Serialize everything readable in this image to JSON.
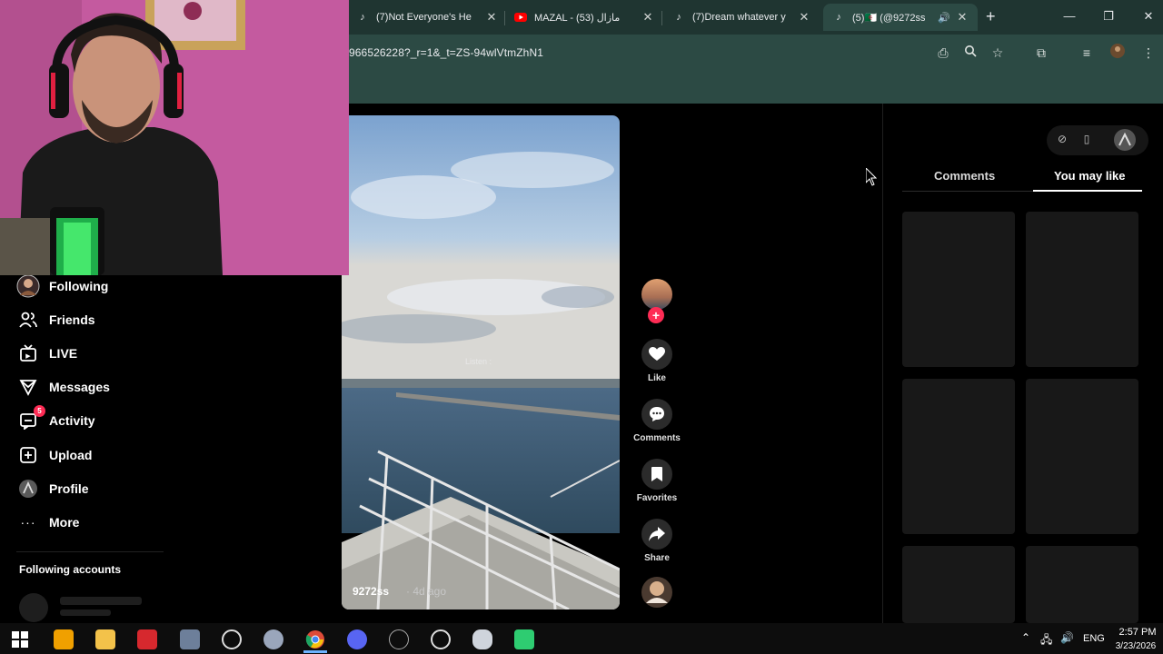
{
  "browser": {
    "tabs": [
      {
        "title": "(7)Not Everyone's He",
        "icon": "tiktok-icon",
        "active": false
      },
      {
        "title": "MAZAL - مازال (53)",
        "icon": "youtube-icon",
        "active": false
      },
      {
        "title": "(7)Dream whatever y",
        "icon": "tiktok-icon",
        "active": false
      },
      {
        "title": "(5)🇩🇿 (@9272ss)",
        "icon": "tiktok-icon",
        "active": true
      }
    ],
    "new_tab_symbol": "+",
    "url": "966526228?_r=1&_t=ZS-94wlVtmZhN1"
  },
  "sidebar": {
    "items": [
      {
        "label": "Following",
        "icon": "avatar-icon"
      },
      {
        "label": "Friends",
        "icon": "friends-icon"
      },
      {
        "label": "LIVE",
        "icon": "live-icon"
      },
      {
        "label": "Messages",
        "icon": "messages-icon"
      },
      {
        "label": "Activity",
        "icon": "activity-icon",
        "badge": "5"
      },
      {
        "label": "Upload",
        "icon": "upload-icon"
      },
      {
        "label": "Profile",
        "icon": "profile-icon"
      },
      {
        "label": "More",
        "icon": "more-icon"
      }
    ],
    "following_accounts": "Following accounts"
  },
  "video": {
    "overlay_text": "Listen :",
    "author": "9272ss",
    "time": "· 4d ago"
  },
  "actions": [
    {
      "label": "Like",
      "icon": "heart-icon"
    },
    {
      "label": "Comments",
      "icon": "comment-icon"
    },
    {
      "label": "Favorites",
      "icon": "bookmark-icon"
    },
    {
      "label": "Share",
      "icon": "share-icon"
    }
  ],
  "right_panel": {
    "tabs": [
      {
        "label": "Comments",
        "active": false
      },
      {
        "label": "You may like",
        "active": true
      }
    ]
  },
  "taskbar": {
    "language": "ENG",
    "time": "2:57 PM",
    "date": "3/23/2026"
  },
  "colors": {
    "tiktok_red": "#fe2c55",
    "browser_frame": "#2c4a44",
    "youtube_red": "#ff0000"
  }
}
